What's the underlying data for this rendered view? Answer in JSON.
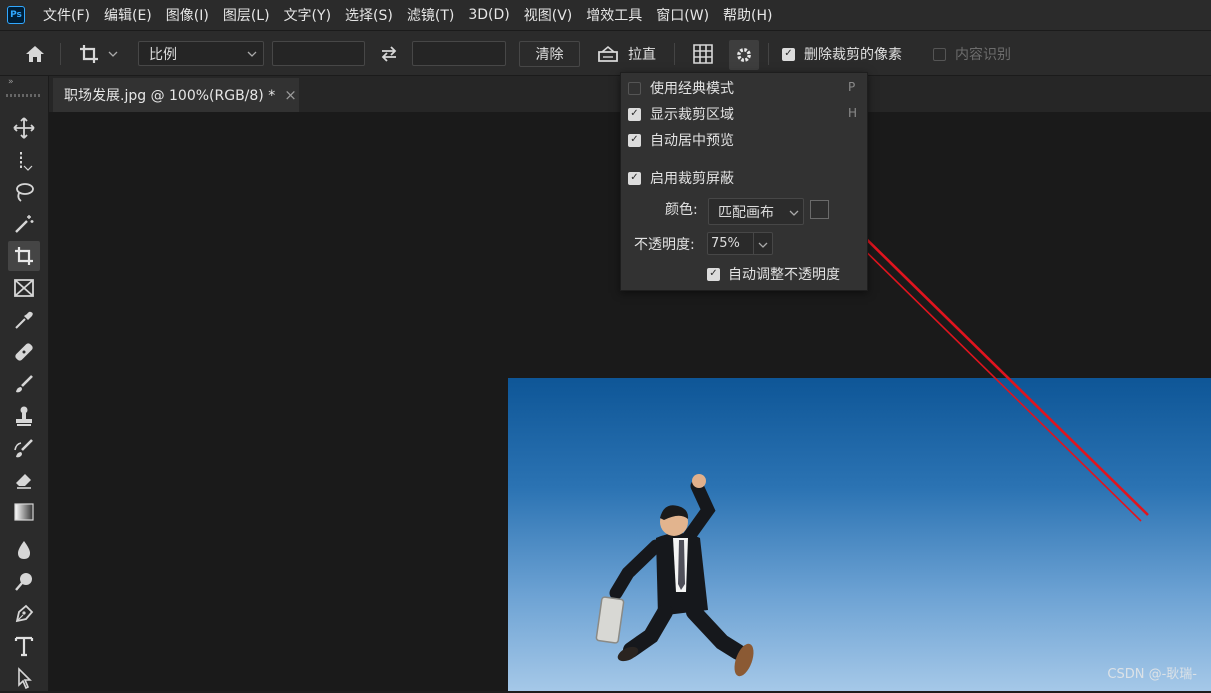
{
  "app": {
    "logo": "Ps"
  },
  "menu": [
    "文件(F)",
    "编辑(E)",
    "图像(I)",
    "图层(L)",
    "文字(Y)",
    "选择(S)",
    "滤镜(T)",
    "3D(D)",
    "视图(V)",
    "增效工具",
    "窗口(W)",
    "帮助(H)"
  ],
  "options": {
    "ratio_value": "比例",
    "width_value": "",
    "height_value": "",
    "clear_label": "清除",
    "straighten_label": "拉直",
    "delete_cropped": {
      "label": "删除裁剪的像素",
      "checked": true
    },
    "content_aware": {
      "label": "内容识别",
      "checked": false
    }
  },
  "document_tab": {
    "title": "职场发展.jpg @ 100%(RGB/8) *",
    "close": "×"
  },
  "crop_settings": {
    "classic_mode": {
      "label": "使用经典模式",
      "checked": false,
      "shortcut": "P"
    },
    "show_crop_area": {
      "label": "显示裁剪区域",
      "checked": true,
      "shortcut": "H"
    },
    "auto_center_preview": {
      "label": "自动居中预览",
      "checked": true
    },
    "enable_crop_shield": {
      "label": "启用裁剪屏蔽",
      "checked": true
    },
    "color_label": "颜色:",
    "color_value": "匹配画布",
    "opacity_label": "不透明度:",
    "opacity_value": "75%",
    "auto_adjust_opacity": {
      "label": "自动调整不透明度",
      "checked": true
    }
  },
  "watermark": "CSDN @-耿瑞-",
  "colors": {
    "annotation_arrow": "#e0141e",
    "accent": "#31a8ff"
  }
}
